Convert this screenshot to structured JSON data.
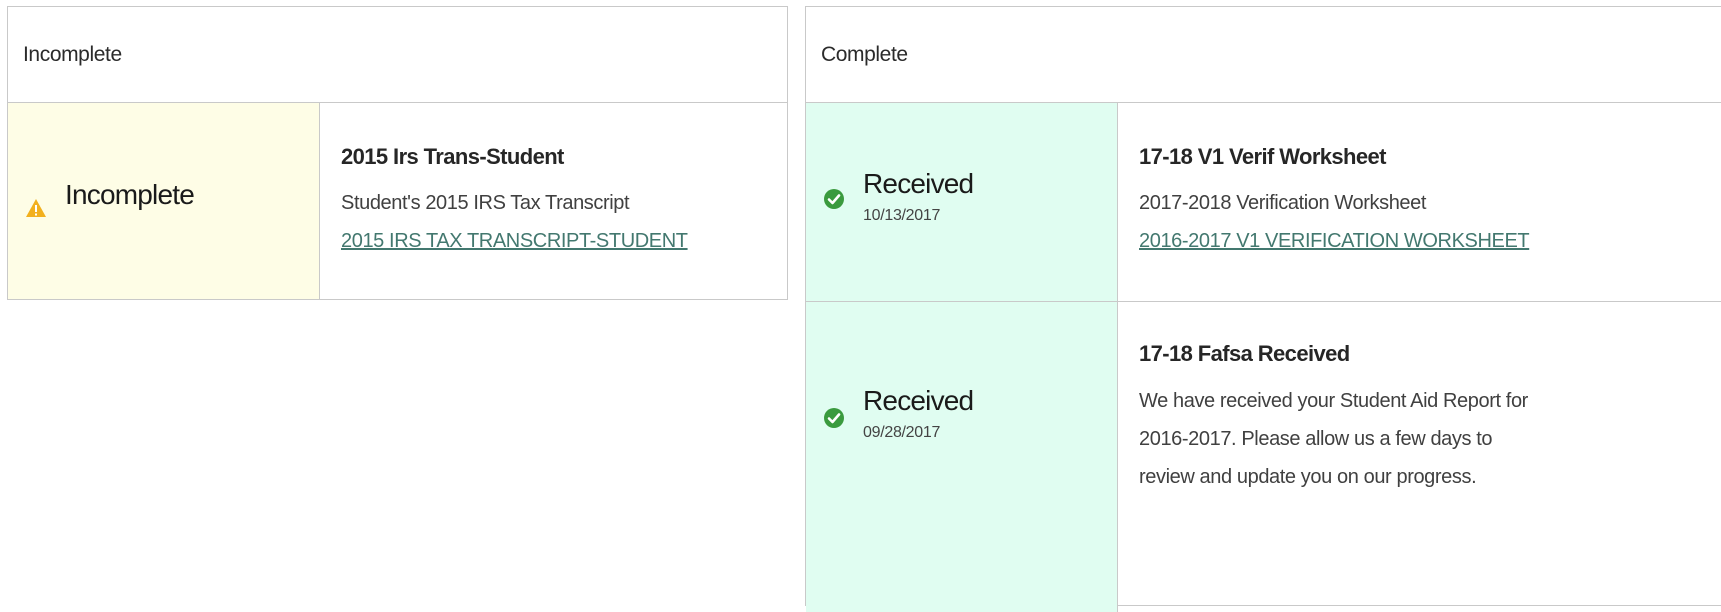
{
  "incomplete_panel": {
    "header": "Incomplete",
    "items": [
      {
        "status": "Incomplete",
        "status_icon": "warning-icon",
        "title": "2015 Irs Trans-Student",
        "description": "Student's 2015 IRS Tax Transcript",
        "link": "2015 IRS TAX TRANSCRIPT-STUDENT"
      }
    ]
  },
  "complete_panel": {
    "header": "Complete",
    "items": [
      {
        "status": "Received",
        "date": "10/13/2017",
        "status_icon": "check-circle-icon",
        "title": "17-18 V1 Verif Worksheet",
        "description": "2017-2018 Verification Worksheet",
        "link": "2016-2017 V1 VERIFICATION WORKSHEET"
      },
      {
        "status": "Received",
        "date": "09/28/2017",
        "status_icon": "check-circle-icon",
        "title": "17-18 Fafsa Received",
        "description": "We have received your Student Aid Report for 2016-2017. Please allow us a few days to review and update you on our progress."
      }
    ]
  },
  "colors": {
    "warning_bg": "#fefde6",
    "success_bg": "#e0fdf1",
    "warning_icon": "#f2b01e",
    "success_icon": "#3a9a3e",
    "link": "#43786f",
    "border": "#c9c9c9"
  }
}
